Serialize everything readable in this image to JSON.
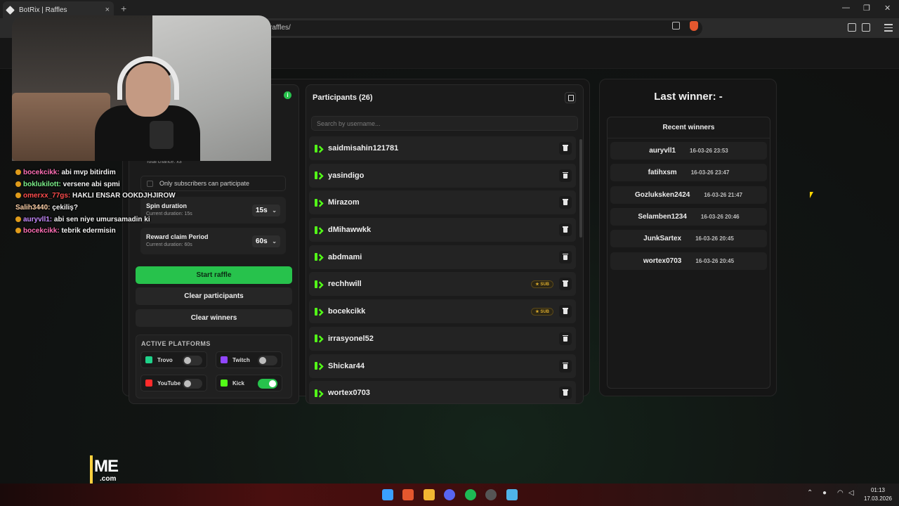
{
  "browser": {
    "tab_title": "BotRix | Raffles",
    "tab_close": "×",
    "new_tab": "+",
    "url_text": "raffles/"
  },
  "left_panel": {
    "status_icon": "i",
    "total_chance": "Total chance: x3",
    "subscribers_only": "Only subscribers can participate",
    "spin_duration": {
      "title": "Spin duration",
      "subtitle": "Current duration: 15s",
      "value": "15s"
    },
    "reward_claim": {
      "title": "Reward claim Period",
      "subtitle": "Current duration: 60s",
      "value": "60s"
    },
    "start_raffle": "Start raffle",
    "clear_participants": "Clear participants",
    "clear_winners": "Clear winners",
    "active_platforms": {
      "heading": "ACTIVE PLATFORMS",
      "items": [
        {
          "label": "Trovo",
          "enabled": false,
          "color": "#1fd28a",
          "icon": "trovo-icon"
        },
        {
          "label": "Twitch",
          "enabled": false,
          "color": "#9146ff",
          "icon": "twitch-icon"
        },
        {
          "label": "YouTube",
          "enabled": false,
          "color": "#ff2b2b",
          "icon": "youtube-icon"
        },
        {
          "label": "Kick",
          "enabled": true,
          "color": "#53fc18",
          "icon": "kick-icon"
        }
      ]
    }
  },
  "participants": {
    "title": "Participants (26)",
    "search_placeholder": "Search by username...",
    "sub_badge": "★ SUB",
    "items": [
      {
        "name": "saidmisahin121781",
        "sub": false
      },
      {
        "name": "yasindigo",
        "sub": false
      },
      {
        "name": "Mirazom",
        "sub": false
      },
      {
        "name": "dMihawwkk",
        "sub": false
      },
      {
        "name": "abdmami",
        "sub": false
      },
      {
        "name": "rechhwill",
        "sub": true
      },
      {
        "name": "bocekcikk",
        "sub": true
      },
      {
        "name": "irrasyonel52",
        "sub": false
      },
      {
        "name": "Shickar44",
        "sub": false
      },
      {
        "name": "wortex0703",
        "sub": false
      }
    ]
  },
  "winners": {
    "last_winner": "Last winner: -",
    "recent_title": "Recent winners",
    "items": [
      {
        "name": "auryvll1",
        "date": "16-03-26 23:53"
      },
      {
        "name": "fatihxsm",
        "date": "16-03-26 23:47"
      },
      {
        "name": "Gozluksken2424",
        "date": "16-03-26 21:47"
      },
      {
        "name": "Selamben1234",
        "date": "16-03-26 20:46"
      },
      {
        "name": "JunkSartex",
        "date": "16-03-26 20:45"
      },
      {
        "name": "wortex0703",
        "date": "16-03-26 20:45"
      }
    ]
  },
  "chat": [
    {
      "user": "bocekcikk:",
      "msg": " abi mvp bitirdim"
    },
    {
      "user": "boklukilott:",
      "msg": " versene abi spmi"
    },
    {
      "user": "omerxx_77gs:",
      "msg": " HAKLI ENSAR OOKDJHJIROW"
    },
    {
      "user": "Salih3440:",
      "msg": " çekiliş?"
    },
    {
      "user": "auryvll1:",
      "msg": " abi sen niye umursamadin ki"
    },
    {
      "user": "bocekcikk:",
      "msg": " tebrik edermisin"
    }
  ],
  "overlay_logo": {
    "main": "ME",
    "sub": ".com"
  },
  "taskbar": {
    "time": "01:13",
    "date": "17.03.2026"
  },
  "colors": {
    "accent_green": "#27c24c",
    "kick_green": "#53fc18",
    "sub_gold": "#d8a92b"
  }
}
